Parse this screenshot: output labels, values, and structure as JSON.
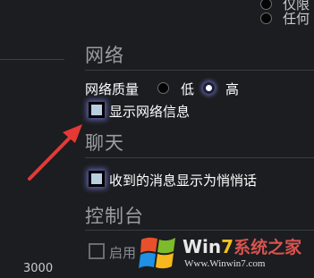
{
  "top_options": [
    {
      "label": "仅限"
    },
    {
      "label": "任何"
    }
  ],
  "sections": {
    "network": {
      "title": "网络",
      "quality_label": "网络质量",
      "quality_options": [
        {
          "label": "低",
          "selected": false
        },
        {
          "label": "高",
          "selected": true
        }
      ],
      "show_network_info": {
        "label": "显示网络信息",
        "checked": true
      }
    },
    "chat": {
      "title": "聊天",
      "whisper": {
        "label": "收到的消息显示为悄悄话",
        "checked": true
      }
    },
    "console": {
      "title": "控制台",
      "enable": {
        "label": "启用",
        "checked": false
      }
    }
  },
  "left_value": "3000",
  "watermark": {
    "brand_win": "Win",
    "brand_seven": "7",
    "brand_cn": "系统之家",
    "url": "Www.Winwin7.com"
  },
  "colors": {
    "background": "#1b1d20",
    "section_title": "#9a9da1",
    "checkbox_fill": "#b8cfe0",
    "arrow": "#e53935"
  }
}
